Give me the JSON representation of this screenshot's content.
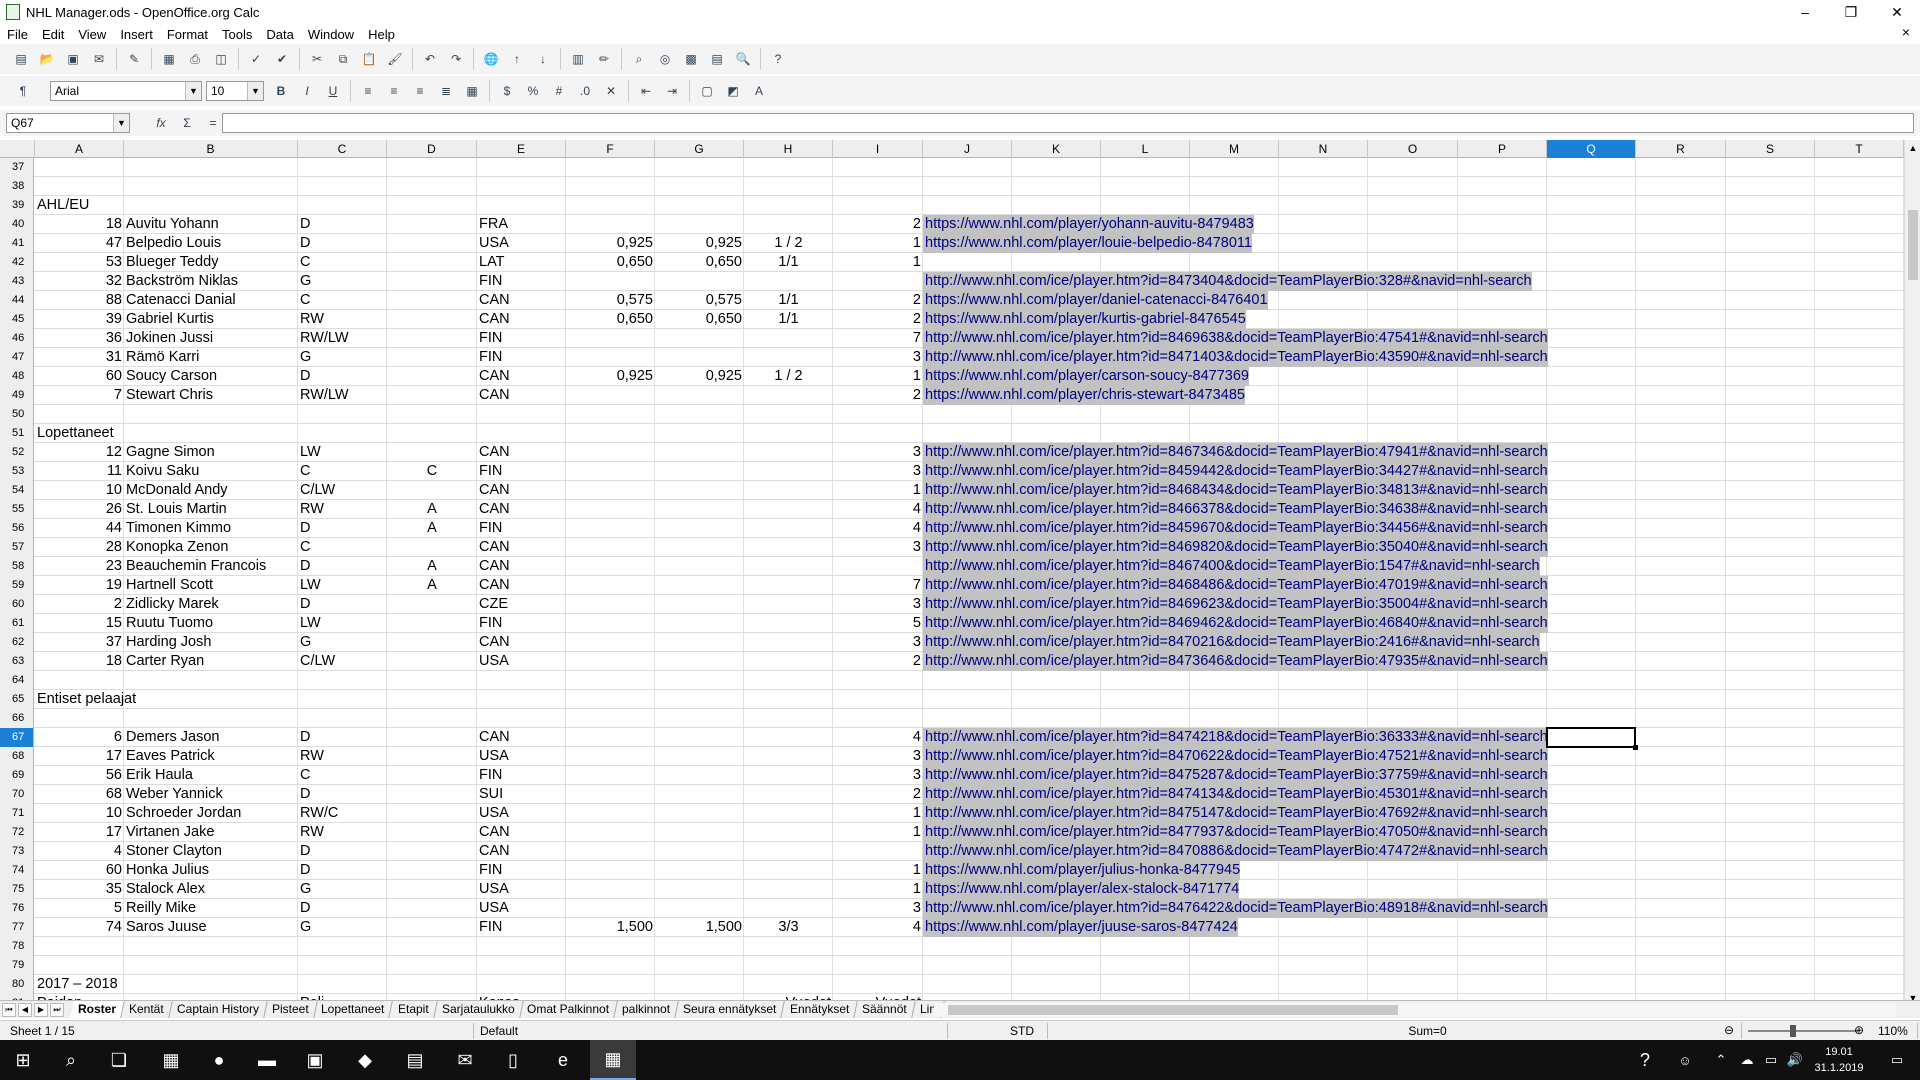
{
  "window": {
    "title": "NHL Manager.ods - OpenOffice.org Calc",
    "minimize": "–",
    "restore": "❐",
    "close": "✕",
    "doc_close": "×"
  },
  "menu": [
    "File",
    "Edit",
    "View",
    "Insert",
    "Format",
    "Tools",
    "Data",
    "Window",
    "Help"
  ],
  "format_toolbar": {
    "font_name": "Arial",
    "font_size": "10",
    "bold": "B",
    "italic": "I",
    "underline": "U"
  },
  "formula_bar": {
    "cell_ref": "Q67",
    "function_wizard": "fx",
    "sum": "Σ",
    "equals": "=",
    "value": ""
  },
  "columns": [
    "A",
    "B",
    "C",
    "D",
    "E",
    "F",
    "G",
    "H",
    "I",
    "J",
    "K",
    "L",
    "M",
    "N",
    "O",
    "P",
    "Q",
    "R",
    "S",
    "T"
  ],
  "active_column": "Q",
  "active_row": 67,
  "rows": [
    {
      "n": 37
    },
    {
      "n": 38
    },
    {
      "n": 39,
      "label": "AHL/EU"
    },
    {
      "n": 40,
      "a": "18",
      "b": "Auvitu Yohann",
      "c": "D",
      "e": "FRA",
      "i": "2",
      "j": "https://www.nhl.com/player/yohann-auvitu-8479483"
    },
    {
      "n": 41,
      "a": "47",
      "b": "Belpedio Louis",
      "c": "D",
      "e": "USA",
      "f": "0,925",
      "g": "0,925",
      "h": "1 / 2",
      "i": "1",
      "j": "https://www.nhl.com/player/louie-belpedio-8478011"
    },
    {
      "n": 42,
      "a": "53",
      "b": "Blueger Teddy",
      "c": "C",
      "e": "LAT",
      "f": "0,650",
      "g": "0,650",
      "h": "1/1",
      "i": "1"
    },
    {
      "n": 43,
      "a": "32",
      "b": "Backström Niklas",
      "c": "G",
      "e": "FIN",
      "j": "http://www.nhl.com/ice/player.htm?id=8473404&docid=TeamPlayerBio:328#&navid=nhl-search"
    },
    {
      "n": 44,
      "a": "88",
      "b": "Catenacci Danial",
      "c": "C",
      "e": "CAN",
      "f": "0,575",
      "g": "0,575",
      "h": "1/1",
      "i": "2",
      "j": "https://www.nhl.com/player/daniel-catenacci-8476401"
    },
    {
      "n": 45,
      "a": "39",
      "b": "Gabriel Kurtis",
      "c": "RW",
      "e": "CAN",
      "f": "0,650",
      "g": "0,650",
      "h": "1/1",
      "i": "2",
      "j": "https://www.nhl.com/player/kurtis-gabriel-8476545"
    },
    {
      "n": 46,
      "a": "36",
      "b": "Jokinen Jussi",
      "c": "RW/LW",
      "e": "FIN",
      "i": "7",
      "j": "http://www.nhl.com/ice/player.htm?id=8469638&docid=TeamPlayerBio:47541#&navid=nhl-search"
    },
    {
      "n": 47,
      "a": "31",
      "b": "Rämö Karri",
      "c": "G",
      "e": "FIN",
      "i": "3",
      "j": "http://www.nhl.com/ice/player.htm?id=8471403&docid=TeamPlayerBio:43590#&navid=nhl-search"
    },
    {
      "n": 48,
      "a": "60",
      "b": "Soucy Carson",
      "c": "D",
      "e": "CAN",
      "f": "0,925",
      "g": "0,925",
      "h": "1 / 2",
      "i": "1",
      "j": "https://www.nhl.com/player/carson-soucy-8477369"
    },
    {
      "n": 49,
      "a": "7",
      "b": "Stewart Chris",
      "c": "RW/LW",
      "e": "CAN",
      "i": "2",
      "j": "https://www.nhl.com/player/chris-stewart-8473485"
    },
    {
      "n": 50
    },
    {
      "n": 51,
      "label": "Lopettaneet"
    },
    {
      "n": 52,
      "a": "12",
      "b": "Gagne Simon",
      "c": "LW",
      "e": "CAN",
      "i": "3",
      "j": "http://www.nhl.com/ice/player.htm?id=8467346&docid=TeamPlayerBio:47941#&navid=nhl-search"
    },
    {
      "n": 53,
      "a": "11",
      "b": "Koivu Saku",
      "c": "C",
      "d": "C",
      "e": "FIN",
      "i": "3",
      "j": "http://www.nhl.com/ice/player.htm?id=8459442&docid=TeamPlayerBio:34427#&navid=nhl-search"
    },
    {
      "n": 54,
      "a": "10",
      "b": "McDonald Andy",
      "c": "C/LW",
      "e": "CAN",
      "i": "1",
      "j": "http://www.nhl.com/ice/player.htm?id=8468434&docid=TeamPlayerBio:34813#&navid=nhl-search"
    },
    {
      "n": 55,
      "a": "26",
      "b": "St. Louis Martin",
      "c": "RW",
      "d": "A",
      "e": "CAN",
      "i": "4",
      "j": "http://www.nhl.com/ice/player.htm?id=8466378&docid=TeamPlayerBio:34638#&navid=nhl-search"
    },
    {
      "n": 56,
      "a": "44",
      "b": "Timonen Kimmo",
      "c": "D",
      "d": "A",
      "e": "FIN",
      "i": "4",
      "j": "http://www.nhl.com/ice/player.htm?id=8459670&docid=TeamPlayerBio:34456#&navid=nhl-search"
    },
    {
      "n": 57,
      "a": "28",
      "b": "Konopka Zenon",
      "c": "C",
      "e": "CAN",
      "i": "3",
      "j": "http://www.nhl.com/ice/player.htm?id=8469820&docid=TeamPlayerBio:35040#&navid=nhl-search"
    },
    {
      "n": 58,
      "a": "23",
      "b": "Beauchemin Francois",
      "c": "D",
      "d": "A",
      "e": "CAN",
      "j": "http://www.nhl.com/ice/player.htm?id=8467400&docid=TeamPlayerBio:1547#&navid=nhl-search"
    },
    {
      "n": 59,
      "a": "19",
      "b": "Hartnell Scott",
      "c": "LW",
      "d": "A",
      "e": "CAN",
      "i": "7",
      "j": "http://www.nhl.com/ice/player.htm?id=8468486&docid=TeamPlayerBio:47019#&navid=nhl-search"
    },
    {
      "n": 60,
      "a": "2",
      "b": "Zidlicky Marek",
      "c": "D",
      "e": "CZE",
      "i": "3",
      "j": "http://www.nhl.com/ice/player.htm?id=8469623&docid=TeamPlayerBio:35004#&navid=nhl-search"
    },
    {
      "n": 61,
      "a": "15",
      "b": "Ruutu Tuomo",
      "c": "LW",
      "e": "FIN",
      "i": "5",
      "j": "http://www.nhl.com/ice/player.htm?id=8469462&docid=TeamPlayerBio:46840#&navid=nhl-search"
    },
    {
      "n": 62,
      "a": "37",
      "b": "Harding Josh",
      "c": "G",
      "e": "CAN",
      "i": "3",
      "j": "http://www.nhl.com/ice/player.htm?id=8470216&docid=TeamPlayerBio:2416#&navid=nhl-search"
    },
    {
      "n": 63,
      "a": "18",
      "b": "Carter Ryan",
      "c": "C/LW",
      "e": "USA",
      "i": "2",
      "j": "http://www.nhl.com/ice/player.htm?id=8473646&docid=TeamPlayerBio:47935#&navid=nhl-search"
    },
    {
      "n": 64
    },
    {
      "n": 65,
      "label": "Entiset pelaajat"
    },
    {
      "n": 66
    },
    {
      "n": 67,
      "a": "6",
      "b": "Demers Jason",
      "c": "D",
      "e": "CAN",
      "i": "4",
      "j": "http://www.nhl.com/ice/player.htm?id=8474218&docid=TeamPlayerBio:36333#&navid=nhl-search"
    },
    {
      "n": 68,
      "a": "17",
      "b": "Eaves Patrick",
      "c": "RW",
      "e": "USA",
      "i": "3",
      "j": "http://www.nhl.com/ice/player.htm?id=8470622&docid=TeamPlayerBio:47521#&navid=nhl-search"
    },
    {
      "n": 69,
      "a": "56",
      "b": "Erik Haula",
      "c": "C",
      "e": "FIN",
      "i": "3",
      "j": "http://www.nhl.com/ice/player.htm?id=8475287&docid=TeamPlayerBio:37759#&navid=nhl-search"
    },
    {
      "n": 70,
      "a": "68",
      "b": "Weber Yannick",
      "c": "D",
      "e": "SUI",
      "i": "2",
      "j": "http://www.nhl.com/ice/player.htm?id=8474134&docid=TeamPlayerBio:45301#&navid=nhl-search"
    },
    {
      "n": 71,
      "a": "10",
      "b": "Schroeder Jordan",
      "c": "RW/C",
      "e": "USA",
      "i": "1",
      "j": "http://www.nhl.com/ice/player.htm?id=8475147&docid=TeamPlayerBio:47692#&navid=nhl-search"
    },
    {
      "n": 72,
      "a": "17",
      "b": "Virtanen Jake",
      "c": "RW",
      "e": "CAN",
      "i": "1",
      "j": "http://www.nhl.com/ice/player.htm?id=8477937&docid=TeamPlayerBio:47050#&navid=nhl-search"
    },
    {
      "n": 73,
      "a": "4",
      "b": "Stoner Clayton",
      "c": "D",
      "e": "CAN",
      "j": "http://www.nhl.com/ice/player.htm?id=8470886&docid=TeamPlayerBio:47472#&navid=nhl-search"
    },
    {
      "n": 74,
      "a": "60",
      "b": "Honka Julius",
      "c": "D",
      "e": "FIN",
      "i": "1",
      "j": "https://www.nhl.com/player/julius-honka-8477945"
    },
    {
      "n": 75,
      "a": "35",
      "b": "Stalock Alex",
      "c": "G",
      "e": "USA",
      "i": "1",
      "j": "https://www.nhl.com/player/alex-stalock-8471774"
    },
    {
      "n": 76,
      "a": "5",
      "b": "Reilly Mike",
      "c": "D",
      "e": "USA",
      "i": "3",
      "j": "http://www.nhl.com/ice/player.htm?id=8476422&docid=TeamPlayerBio:48918#&navid=nhl-search"
    },
    {
      "n": 77,
      "a": "74",
      "b": "Saros Juuse",
      "c": "G",
      "e": "FIN",
      "f": "1,500",
      "g": "1,500",
      "h": "3/3",
      "i": "4",
      "j": "https://www.nhl.com/player/juuse-saros-8477424"
    },
    {
      "n": 78
    },
    {
      "n": 79
    },
    {
      "n": 80,
      "label": "2017 – 2018"
    },
    {
      "n": 81,
      "a": "Paidan",
      "c": "Peli",
      "e": "Kansa",
      "h": "Vuodet",
      "i": "Vuodet"
    }
  ],
  "sheet_tabs": [
    "Roster",
    "Kentät",
    "Captain History",
    "Pisteet",
    "Lopettaneet",
    "Etapit",
    "Sarjataulukko",
    "Omat Palkinnot",
    "palkinnot",
    "Seura ennätykset",
    "Ennätykset",
    "Säännöt",
    "Lin"
  ],
  "active_tab": "Roster",
  "status": {
    "sheet": "Sheet 1 / 15",
    "page_style": "Default",
    "mode": "STD",
    "sum": "Sum=0",
    "zoom": "110%"
  },
  "taskbar": {
    "time": "19.01",
    "date": "31.1.2019"
  },
  "colors": {
    "selection_blue": "#1a81d6",
    "url_highlight": "#c2c2c2",
    "url_text": "#000080"
  }
}
